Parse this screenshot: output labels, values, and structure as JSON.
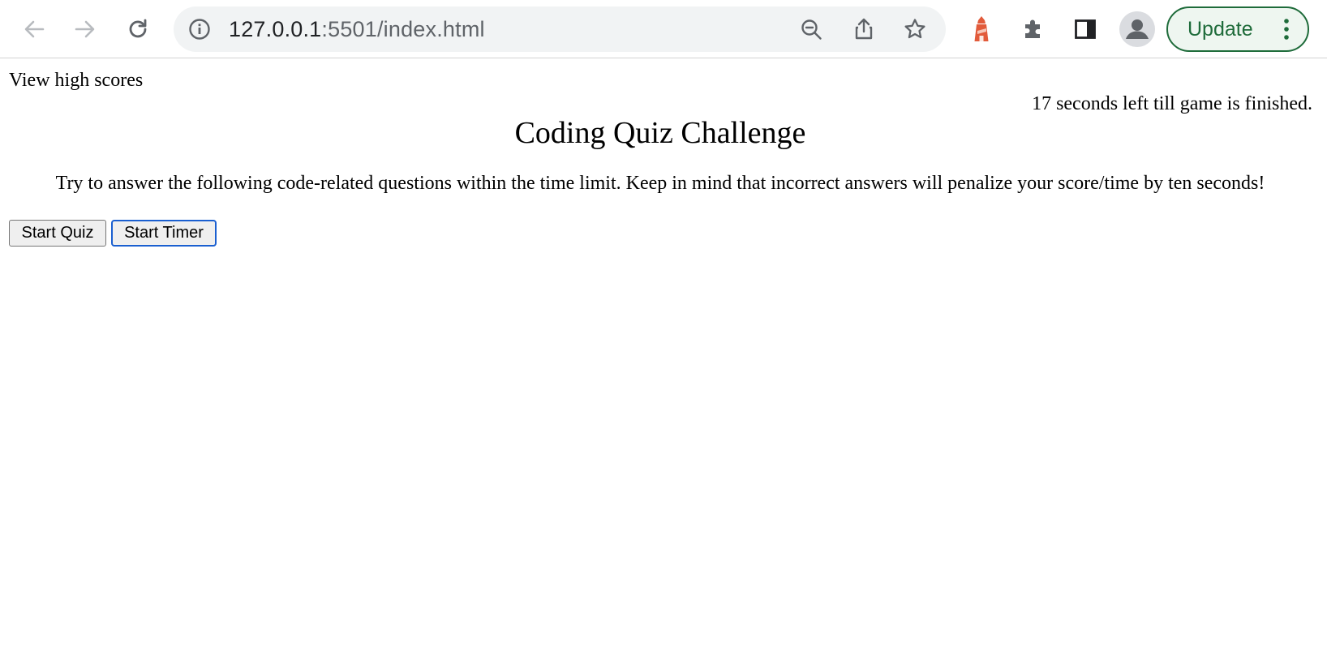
{
  "browser": {
    "address": {
      "host": "127.0.0.1",
      "rest": ":5501/index.html"
    },
    "update_label": "Update",
    "icons": {
      "back": "back-arrow-icon",
      "forward": "forward-arrow-icon",
      "reload": "reload-icon",
      "site_info": "info-icon",
      "zoom": "zoom-out-icon",
      "share": "share-icon",
      "bookmark": "star-icon",
      "extension_1": "lighthouse-icon",
      "extensions": "puzzle-icon",
      "side_panel": "side-panel-icon",
      "profile": "avatar-icon",
      "menu": "kebab-menu-icon"
    },
    "colors": {
      "update_accent": "#1e6b3a",
      "lighthouse": "#e25b3b",
      "omnibox_bg": "#f1f3f4"
    }
  },
  "page": {
    "view_high_scores": "View high scores",
    "timer_text": "17 seconds left till game is finished.",
    "title": "Coding Quiz Challenge",
    "instructions": "Try to answer the following code-related questions within the time limit. Keep in mind that incorrect answers will penalize your score/time by ten seconds!",
    "buttons": {
      "start_quiz": "Start Quiz",
      "start_timer": "Start Timer"
    }
  }
}
